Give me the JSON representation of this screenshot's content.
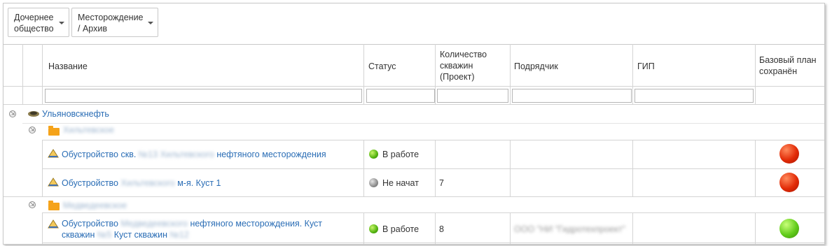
{
  "filters": [
    {
      "label": "Дочернее\nобщество"
    },
    {
      "label": "Месторождение\n/ Архив"
    }
  ],
  "columns": {
    "name": "Название",
    "status": "Статус",
    "wells": "Количество\nскважин\n(Проект)",
    "contractor": "Подрядчик",
    "gip": "ГИП",
    "baseline": "Базовый план\nсохранён"
  },
  "tree": {
    "root": {
      "label": "Ульяновскнефть"
    },
    "group1": {
      "label": "Хильтевское"
    },
    "group2": {
      "label": "Медведеевское"
    },
    "rows": [
      {
        "name_prefix": "Обустройство скв.",
        "name_blur": "№13 Хильтевского",
        "name_suffix": "нефтяного месторождения",
        "status": "В работе",
        "wells": "",
        "contractor": "",
        "baseline_color": "#e22b07"
      },
      {
        "name_prefix": "Обустройство ",
        "name_blur": "Хильтевского",
        "name_suffix": "м-я. Куст 1",
        "status": "Не начат",
        "wells": "7",
        "contractor": "",
        "baseline_color": "#e22b07"
      },
      {
        "name_prefix": "Обустройство",
        "name_blur": "Медведеевского",
        "name_suffix": "нефтяного месторождения. Куст",
        "name_line2_prefix": "скважин",
        "name_line2_blur": "№5",
        "name_line2_mid": "Куст скважин",
        "name_line2_blur2": "№12",
        "status": "В работе",
        "wells": "8",
        "contractor": "ООО \"НИ \"Гидротехпроект\"",
        "baseline_color": "#62cc1b"
      }
    ]
  },
  "colors": {
    "link": "#2a6db5",
    "folder": "#f5a31a",
    "grid": "#d4d4d4"
  }
}
